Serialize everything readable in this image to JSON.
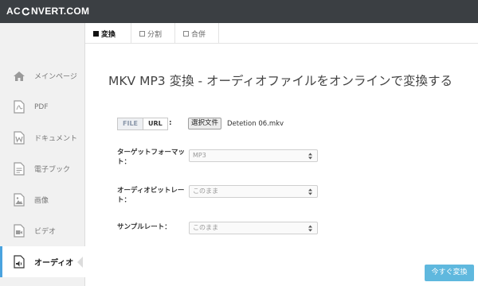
{
  "header": {
    "logo_text_left": "AC",
    "logo_text_right": "NVERT.COM"
  },
  "tabs": [
    {
      "label": "変換",
      "active": true
    },
    {
      "label": "分割",
      "active": false
    },
    {
      "label": "合併",
      "active": false
    }
  ],
  "sidebar": {
    "items": [
      {
        "label": "メインページ",
        "icon": "home-icon",
        "active": false
      },
      {
        "label": "PDF",
        "icon": "pdf-file-icon",
        "active": false
      },
      {
        "label": "ドキュメント",
        "icon": "word-document-icon",
        "active": false
      },
      {
        "label": "電子ブック",
        "icon": "ebook-icon",
        "active": false
      },
      {
        "label": "画像",
        "icon": "image-icon",
        "active": false
      },
      {
        "label": "ビデオ",
        "icon": "video-icon",
        "active": false
      },
      {
        "label": "オーディオ",
        "icon": "audio-icon",
        "active": true
      }
    ]
  },
  "main": {
    "title": "MKV MP3 変換 - オーディオファイルをオンラインで変換する",
    "source": {
      "file_label": "FILE",
      "url_label": "URL",
      "colon": ":",
      "choose_button": "選択文件",
      "file_name": "Detetion 06.mkv"
    },
    "fields": [
      {
        "label_line1": "ターゲットフォーマッ",
        "label_line2": "ト：",
        "value": "MP3"
      },
      {
        "label_line1": "オーディオビットレー",
        "label_line2": "ト：",
        "value": "このまま"
      },
      {
        "label_line1": "サンプルレート：",
        "label_line2": "",
        "value": "このまま"
      }
    ],
    "convert_button": "今すぐ変換"
  },
  "colors": {
    "topbar": "#3b3f43",
    "sidebar_bg": "#f1f1f1",
    "accent": "#5fb8de"
  }
}
